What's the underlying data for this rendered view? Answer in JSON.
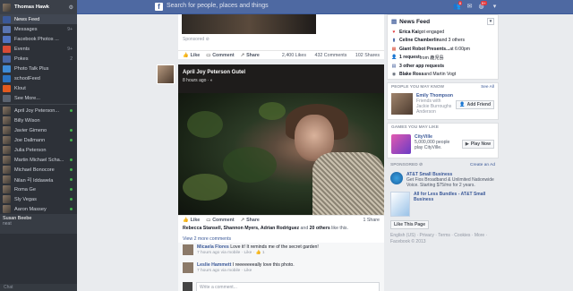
{
  "sidebar": {
    "user": "Thomas Hawk",
    "apps": [
      {
        "label": "News Feed",
        "count": "",
        "color": "#3b5998",
        "active": true
      },
      {
        "label": "Messages",
        "count": "9+",
        "color": "#5a75b1"
      },
      {
        "label": "Facebook Photos ...",
        "count": "",
        "color": "#5173c1"
      },
      {
        "label": "Events",
        "count": "9+",
        "color": "#d94b34"
      },
      {
        "label": "Pokes",
        "count": "2",
        "color": "#4a67a5"
      },
      {
        "label": "Photo Talk Plus",
        "count": "",
        "color": "#3f8bd6"
      },
      {
        "label": "schoolFeed",
        "count": "",
        "color": "#2b73c2"
      },
      {
        "label": "Klout",
        "count": "",
        "color": "#e25a1f"
      },
      {
        "label": "See More...",
        "count": "",
        "color": "#5b6370"
      }
    ],
    "friends": [
      {
        "name": "April Joy Peterson...",
        "online": true
      },
      {
        "name": "Billy Wilson",
        "online": false
      },
      {
        "name": "Javier Gimeno",
        "online": true
      },
      {
        "name": "Joe Dallmann",
        "online": true
      },
      {
        "name": "Julia Peterson",
        "online": false
      },
      {
        "name": "Martin Michael Scha...",
        "online": true
      },
      {
        "name": "Michael Bonocore",
        "online": true
      },
      {
        "name": "Nilan 리 Iddawela",
        "online": true
      },
      {
        "name": "Roma Ge",
        "online": true
      },
      {
        "name": "Sly Vegas",
        "online": true
      },
      {
        "name": "Aaron Massey",
        "online": true
      }
    ],
    "message": {
      "name": "Susan Beebe",
      "text": "neat"
    },
    "chat": "Chat"
  },
  "topbar": {
    "logo": "f",
    "search_placeholder": "Search for people, places and things",
    "badge_friends": "6",
    "badge_notif": "9+"
  },
  "feed": {
    "sponsored": "Sponsored ⊘",
    "prev_actions": {
      "like": "Like",
      "comment": "Comment",
      "share": "Share",
      "likes": "2,400 Likes",
      "comments": "432 Comments",
      "shares": "102 Shares"
    },
    "post": {
      "author": "April Joy Peterson Gutel",
      "time": "8 hours ago · ◐",
      "actions": {
        "like": "Like",
        "comment": "Comment",
        "share": "Share",
        "shares": "1 Share"
      },
      "likes_line": {
        "names": "Rebecca Stansell, Shannon Myers, Adrian Rodriguez",
        "rest": " and ",
        "others": "20 others",
        "tail": " like this."
      },
      "view_more": "View 2 more comments",
      "comments": [
        {
          "author": "Micaela Flores",
          "text": " Love it! It reminds me of the secret garden!",
          "meta": "7 hours ago via mobile · Like · 👍 1"
        },
        {
          "author": "Leslie Hammett",
          "text": " I reeeeeeeally love this photo.",
          "meta": "7 hours ago via mobile · Like"
        }
      ],
      "write_placeholder": "Write a comment..."
    }
  },
  "right": {
    "newsfeed_title": "News Feed",
    "ticker": [
      {
        "icon": "♥",
        "color": "#e0393e",
        "name": "Erica Kai",
        "text": " got engaged"
      },
      {
        "icon": "▮",
        "color": "#4a67a5",
        "name": "Celine Chamberlin",
        "text": " and 3 others"
      },
      {
        "icon": "▦",
        "color": "#d94b34",
        "name": "Giant Robot Presents...",
        "text": " at 6:00pm"
      },
      {
        "icon": "👤",
        "color": "#4a67a5",
        "name": "1 request",
        "text": " from 鹿児島"
      },
      {
        "icon": "▤",
        "color": "#3b5998",
        "name": "3 other app requests",
        "text": ""
      },
      {
        "icon": "◉",
        "color": "#5b6370",
        "name": "Blake Ross",
        "text": " and Martin Vogt"
      }
    ],
    "pymk": {
      "title": "People You May Know",
      "see_all": "See All",
      "name": "Emily Thompson",
      "sub": "Friends with Jackie Burroughs Anderson",
      "button": "Add Friend"
    },
    "games": {
      "title": "Games You May Like",
      "name": "CityVille",
      "sub": "5,000,000 people play CityVille.",
      "button": "Play Now"
    },
    "sponsored": {
      "title": "Sponsored ⊘",
      "create": "Create an Ad",
      "ad1": {
        "name": "AT&T Small Business",
        "sub": "Get Fios Broadband & Unlimited Nationwide Voice. Starting $75/mo for 2 years."
      },
      "ad2": {
        "name": "All for Less Bundles - AT&T Small Business",
        "button": "Like This Page"
      }
    },
    "footer": "English (US) · Privacy · Terms · Cookies · More · Facebook © 2013"
  }
}
